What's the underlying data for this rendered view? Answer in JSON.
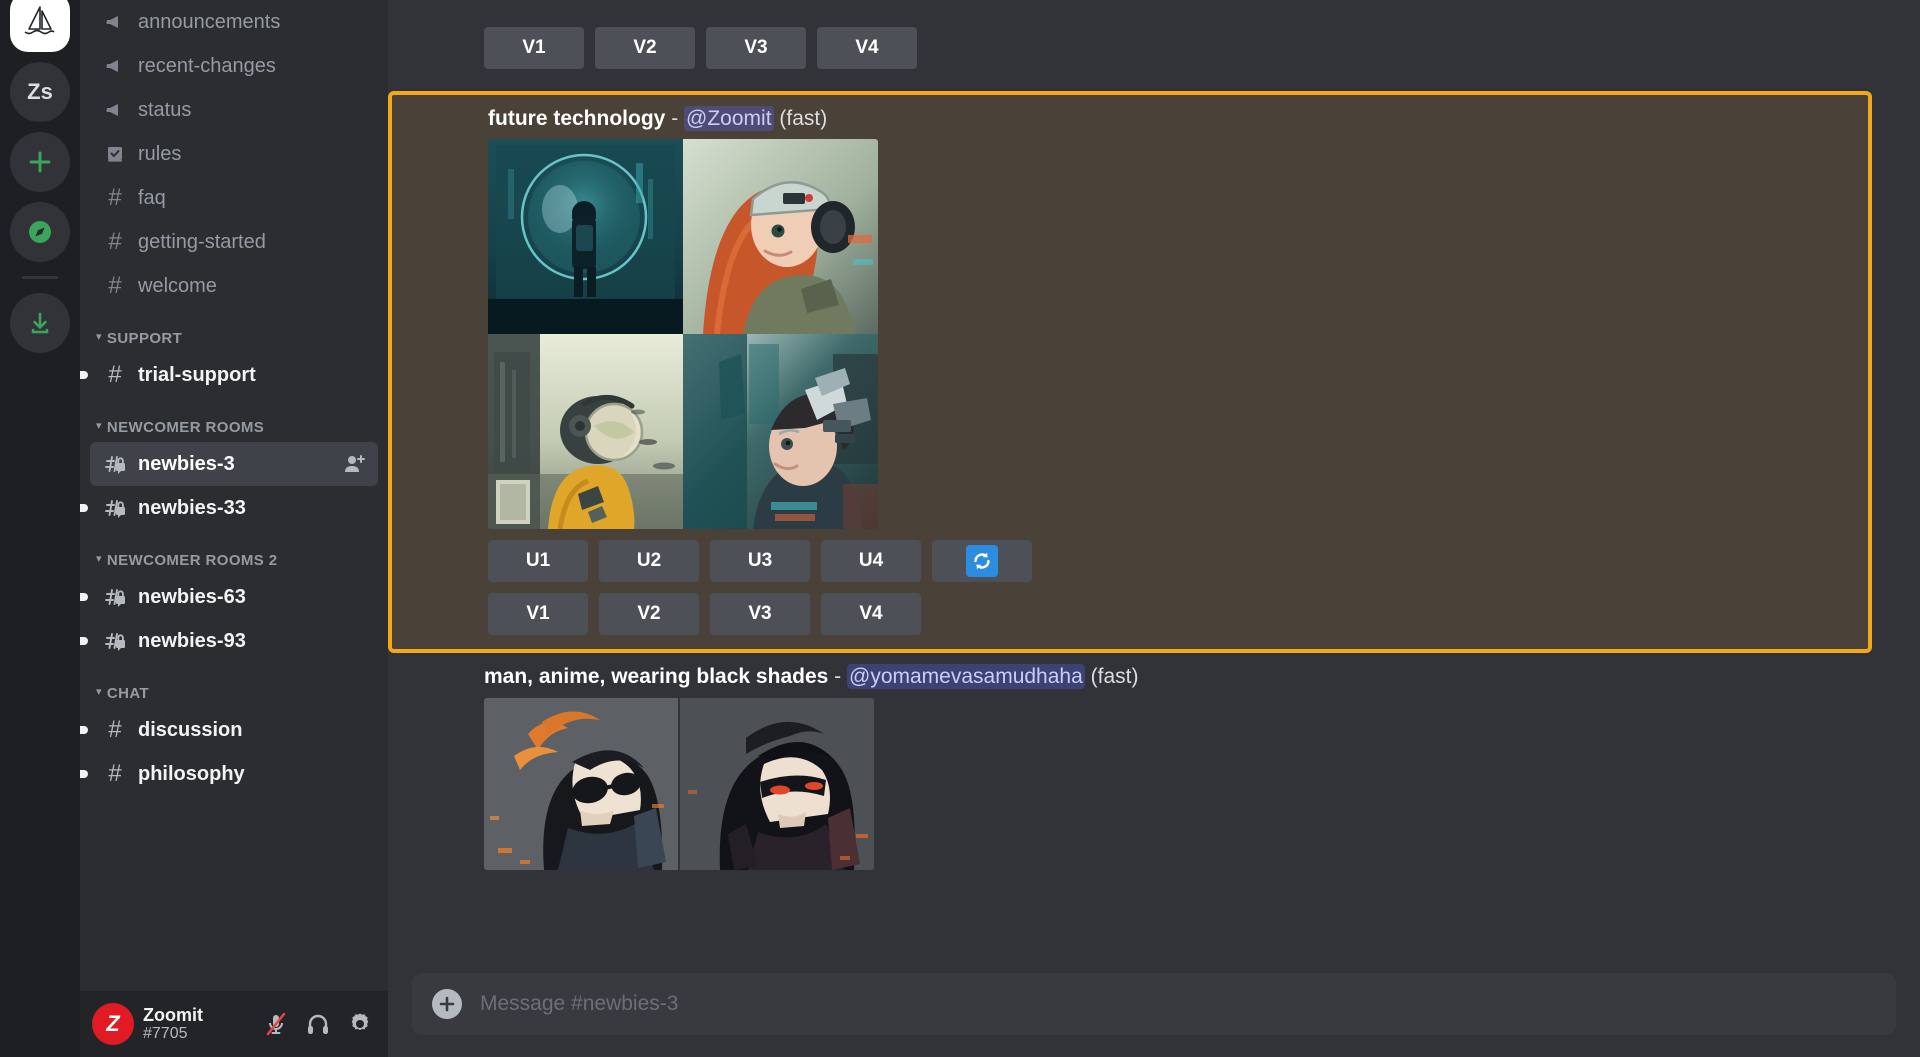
{
  "server_rail": {
    "items": [
      {
        "name": "home-server",
        "icon": "sailboat-icon",
        "label": ""
      },
      {
        "name": "server-zs",
        "icon": "text-avatar",
        "label": "Zs"
      },
      {
        "name": "add-server",
        "icon": "plus-icon",
        "label": ""
      },
      {
        "name": "explore-servers",
        "icon": "compass-icon",
        "label": ""
      },
      {
        "name": "download-apps",
        "icon": "download-icon",
        "label": ""
      }
    ]
  },
  "sidebar": {
    "groups": [
      {
        "label": "",
        "has_header": false,
        "items": [
          {
            "label": "announcements",
            "icon": "megaphone-icon",
            "state": "normal",
            "unread": false,
            "pip": false
          },
          {
            "label": "recent-changes",
            "icon": "megaphone-icon",
            "state": "normal",
            "unread": false,
            "pip": false
          },
          {
            "label": "status",
            "icon": "megaphone-icon",
            "state": "normal",
            "unread": false,
            "pip": false
          },
          {
            "label": "rules",
            "icon": "rules-book-icon",
            "state": "normal",
            "unread": false,
            "pip": false
          },
          {
            "label": "faq",
            "icon": "hash-icon",
            "state": "normal",
            "unread": false,
            "pip": false
          },
          {
            "label": "getting-started",
            "icon": "hash-icon",
            "state": "normal",
            "unread": false,
            "pip": false
          },
          {
            "label": "welcome",
            "icon": "hash-icon",
            "state": "normal",
            "unread": false,
            "pip": false
          }
        ]
      },
      {
        "label": "SUPPORT",
        "has_header": true,
        "items": [
          {
            "label": "trial-support",
            "icon": "hash-icon",
            "state": "unread",
            "unread": true,
            "pip": true
          }
        ]
      },
      {
        "label": "NEWCOMER ROOMS",
        "has_header": true,
        "items": [
          {
            "label": "newbies-3",
            "icon": "private-thread-icon",
            "state": "active",
            "unread": true,
            "pip": false,
            "trailing": "add-member-icon"
          },
          {
            "label": "newbies-33",
            "icon": "private-thread-icon",
            "state": "unread",
            "unread": true,
            "pip": true
          }
        ]
      },
      {
        "label": "NEWCOMER ROOMS 2",
        "has_header": true,
        "items": [
          {
            "label": "newbies-63",
            "icon": "private-thread-icon",
            "state": "unread",
            "unread": true,
            "pip": true
          },
          {
            "label": "newbies-93",
            "icon": "private-thread-icon",
            "state": "unread",
            "unread": true,
            "pip": true
          }
        ]
      },
      {
        "label": "CHAT",
        "has_header": true,
        "items": [
          {
            "label": "discussion",
            "icon": "hash-icon",
            "state": "unread",
            "unread": true,
            "pip": true
          },
          {
            "label": "philosophy",
            "icon": "hash-icon",
            "state": "unread",
            "unread": true,
            "pip": true
          }
        ]
      }
    ]
  },
  "user_panel": {
    "avatar_letter": "Z",
    "avatar_color": "#E01B24",
    "username": "Zoomit",
    "discriminator": "#7705",
    "icons": [
      {
        "name": "mute-microphone-icon",
        "muted": true
      },
      {
        "name": "deafen-headphones-icon",
        "muted": false
      },
      {
        "name": "user-settings-gear-icon",
        "muted": false
      }
    ]
  },
  "chat": {
    "highlight_border_color": "#F2A818",
    "highlight_background": "#4A4239",
    "messages": [
      {
        "id": "msg-partial-top",
        "partial": true,
        "highlighted": false,
        "buttons_v": [
          "V1",
          "V2",
          "V3",
          "V4"
        ]
      },
      {
        "id": "msg-future-technology",
        "highlighted": true,
        "prompt": "future technology",
        "separator": "-",
        "mention": "@Zoomit",
        "speed": "(fast)",
        "grid": {
          "type": "2x2",
          "cells": [
            {
              "name": "astronaut-child-window",
              "desc": "child in spacesuit before giant helmet visor, teal cyberpunk"
            },
            {
              "name": "goggles-girl-portrait",
              "desc": "red-haired girl with tech goggles and headphones"
            },
            {
              "name": "yellow-diver-figure",
              "desc": "yellow-suited figure with round helmet over ruined city"
            },
            {
              "name": "cyborg-boy-portrait",
              "desc": "boy with mechanical headpiece, teal city backdrop"
            }
          ]
        },
        "buttons_u": [
          "U1",
          "U2",
          "U3",
          "U4"
        ],
        "reroll_button": {
          "name": "reroll-button",
          "icon": "refresh-icon",
          "color": "#2C8DE0"
        },
        "buttons_v": [
          "V1",
          "V2",
          "V3",
          "V4"
        ]
      },
      {
        "id": "msg-man-anime-black-shades",
        "highlighted": false,
        "prompt": "man, anime, wearing black shades",
        "separator": "-",
        "mention": "@yomamevasamudhaha",
        "speed": "(fast)",
        "pair": {
          "cells": [
            {
              "name": "anime-man-sunglasses-left",
              "desc": "anime man with spiky black hair and dark round shades"
            },
            {
              "name": "anime-man-sunglasses-right",
              "desc": "anime man with black hair and glowing red-lit shades"
            }
          ]
        }
      }
    ]
  },
  "composer": {
    "attach_label": "+",
    "placeholder": "Message #newbies-3",
    "value": ""
  }
}
